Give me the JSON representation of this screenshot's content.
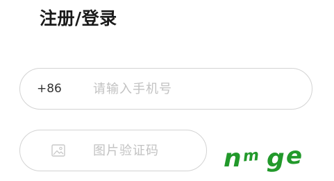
{
  "header": {
    "title": "注册/登录"
  },
  "phone": {
    "prefix": "+86",
    "placeholder": "请输入手机号",
    "value": ""
  },
  "image_code": {
    "icon": "image-icon",
    "placeholder": "图片验证码",
    "value": ""
  },
  "captcha": {
    "text": "nmge",
    "color": "#22992b"
  },
  "colors": {
    "border": "#d3d3d3",
    "placeholder": "#c2c2c2",
    "title": "#1a1a1a"
  }
}
